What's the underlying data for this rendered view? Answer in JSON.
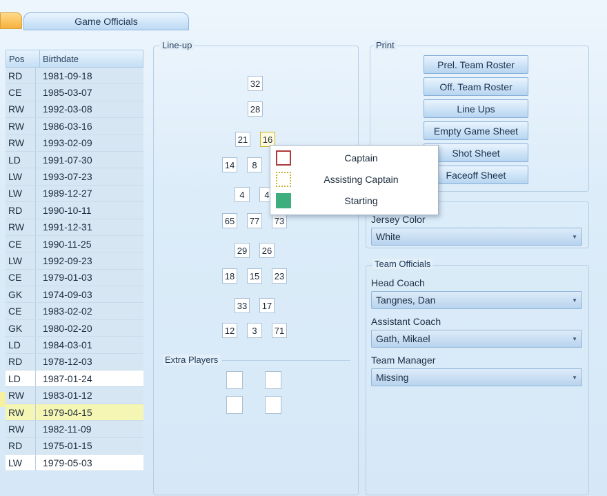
{
  "tabs": {
    "active_label": "Game Officials"
  },
  "grid": {
    "headers": {
      "pos": "Pos",
      "birthdate": "Birthdate"
    },
    "rows": [
      {
        "pos": "RD",
        "birthdate": "1981-09-18",
        "style": "blue"
      },
      {
        "pos": "CE",
        "birthdate": "1985-03-07",
        "style": "blue"
      },
      {
        "pos": "RW",
        "birthdate": "1992-03-08",
        "style": "blue"
      },
      {
        "pos": "RW",
        "birthdate": "1986-03-16",
        "style": "blue"
      },
      {
        "pos": "RW",
        "birthdate": "1993-02-09",
        "style": "blue"
      },
      {
        "pos": "LD",
        "birthdate": "1991-07-30",
        "style": "blue"
      },
      {
        "pos": "LW",
        "birthdate": "1993-07-23",
        "style": "blue"
      },
      {
        "pos": "LW",
        "birthdate": "1989-12-27",
        "style": "blue"
      },
      {
        "pos": "RD",
        "birthdate": "1990-10-11",
        "style": "blue"
      },
      {
        "pos": "RW",
        "birthdate": "1991-12-31",
        "style": "blue"
      },
      {
        "pos": "CE",
        "birthdate": "1990-11-25",
        "style": "blue"
      },
      {
        "pos": "LW",
        "birthdate": "1992-09-23",
        "style": "blue"
      },
      {
        "pos": "CE",
        "birthdate": "1979-01-03",
        "style": "blue"
      },
      {
        "pos": "GK",
        "birthdate": "1974-09-03",
        "style": "blue"
      },
      {
        "pos": "CE",
        "birthdate": "1983-02-02",
        "style": "blue"
      },
      {
        "pos": "GK",
        "birthdate": "1980-02-20",
        "style": "blue"
      },
      {
        "pos": "LD",
        "birthdate": "1984-03-01",
        "style": "blue"
      },
      {
        "pos": "RD",
        "birthdate": "1978-12-03",
        "style": "blue"
      },
      {
        "pos": "LD",
        "birthdate": "1987-01-24",
        "style": "white"
      },
      {
        "pos": "RW",
        "birthdate": "1983-01-12",
        "style": "blue"
      },
      {
        "pos": "RW",
        "birthdate": "1979-04-15",
        "style": "sel"
      },
      {
        "pos": "RW",
        "birthdate": "1982-11-09",
        "style": "blue"
      },
      {
        "pos": "RD",
        "birthdate": "1975-01-15",
        "style": "blue"
      },
      {
        "pos": "LW",
        "birthdate": "1979-05-03",
        "style": "white"
      }
    ]
  },
  "lineup": {
    "title": "Line-up",
    "jerseys": [
      "32",
      "28",
      "21",
      "16",
      "14",
      "8",
      "4",
      "4",
      "65",
      "77",
      "73",
      "29",
      "26",
      "18",
      "15",
      "23",
      "33",
      "17",
      "12",
      "3",
      "71"
    ]
  },
  "extra_players": {
    "title": "Extra Players"
  },
  "context_menu": {
    "items": [
      {
        "label": "Captain",
        "icon": "captain-icon"
      },
      {
        "label": "Assisting Captain",
        "icon": "assisting-captain-icon"
      },
      {
        "label": "Starting",
        "icon": "starting-icon"
      }
    ]
  },
  "print": {
    "title": "Print",
    "buttons": [
      "Prel. Team Roster",
      "Off. Team Roster",
      "Line Ups",
      "Empty Game Sheet",
      "Shot Sheet",
      "Faceoff Sheet"
    ]
  },
  "jersey": {
    "label": "Jersey Color",
    "value": "White"
  },
  "team_officials": {
    "title": "Team Officials",
    "head_coach_label": "Head Coach",
    "head_coach_value": "Tangnes, Dan",
    "assistant_coach_label": "Assistant Coach",
    "assistant_coach_value": "Gath, Mikael",
    "team_manager_label": "Team Manager",
    "team_manager_value": "Missing"
  },
  "colors": {
    "captain": "#b0383c",
    "assisting": "#c9b12e",
    "starting": "#3fae7e",
    "selected_row": "#f5f6b4"
  }
}
